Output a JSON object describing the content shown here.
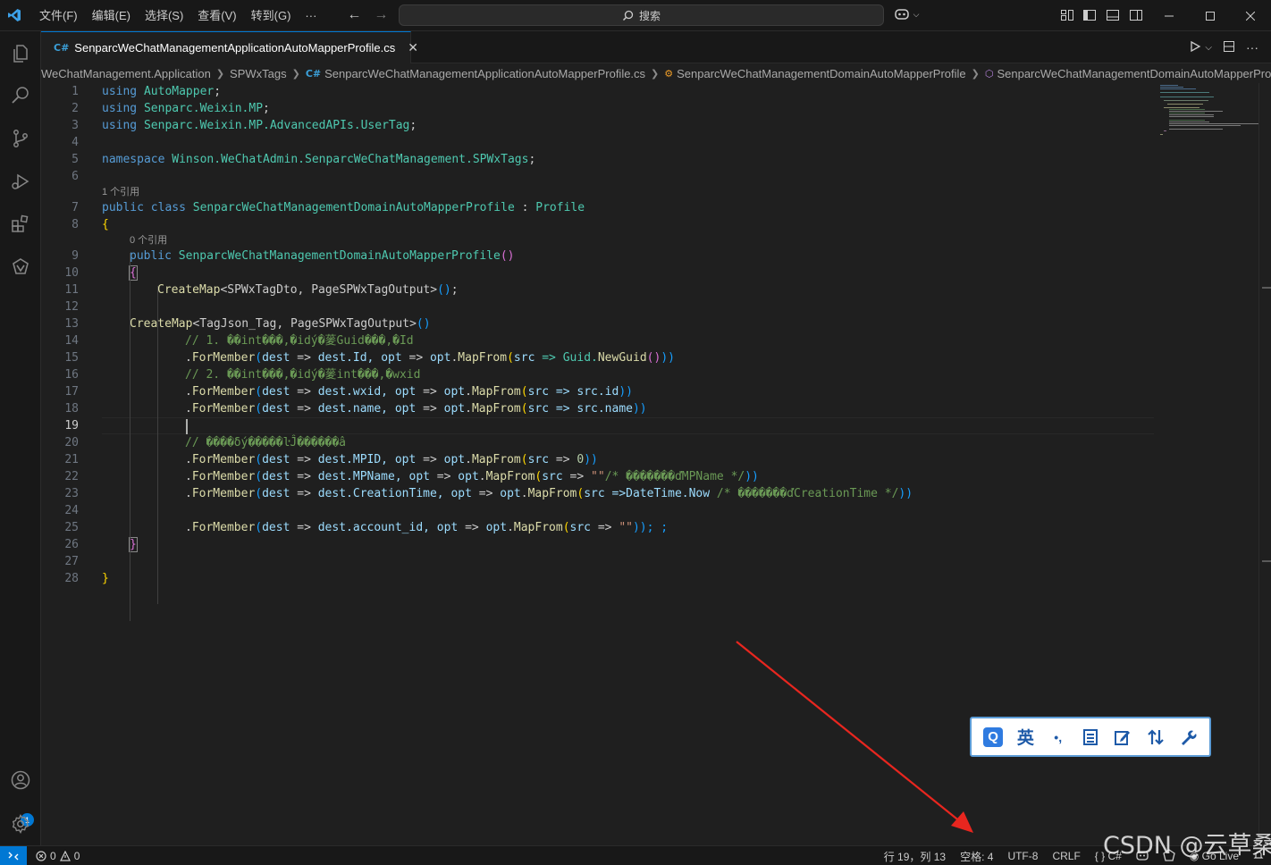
{
  "menu": [
    "文件(F)",
    "编辑(E)",
    "选择(S)",
    "查看(V)",
    "转到(G)",
    "···"
  ],
  "search": {
    "placeholder": "搜索"
  },
  "tab": {
    "label": "SenparcWeChatManagementApplicationAutoMapperProfile.cs",
    "close": "✕"
  },
  "breadcrumb": [
    "WeChatManagement.Application",
    "SPWxTags",
    "SenparcWeChatManagementApplicationAutoMapperProfile.cs",
    "SenparcWeChatManagementDomainAutoMapperProfile",
    "SenparcWeChatManagementDomainAutoMapperProfile"
  ],
  "codelens": {
    "class_refs": "1 个引用",
    "ctor_refs": "0 个引用"
  },
  "code": {
    "line_numbers": [
      "1",
      "2",
      "3",
      "4",
      "5",
      "6",
      "7",
      "8",
      "9",
      "10",
      "11",
      "12",
      "13",
      "14",
      "15",
      "16",
      "17",
      "18",
      "19",
      "20",
      "21",
      "22",
      "23",
      "24",
      "25",
      "26",
      "27",
      "28"
    ],
    "current_line": "19",
    "l1": {
      "a": "using",
      "b": "AutoMapper",
      "c": ";"
    },
    "l2": {
      "a": "using",
      "b": "Senparc.Weixin.MP",
      "c": ";"
    },
    "l3": {
      "a": "using",
      "b": "Senparc.Weixin.MP.AdvancedAPIs.UserTag",
      "c": ";"
    },
    "l5": {
      "a": "namespace",
      "b": "Winson.WeChatAdmin.SenparcWeChatManagement.SPWxTags",
      "c": ";"
    },
    "l7": {
      "a": "public class",
      "b": "SenparcWeChatManagementDomainAutoMapperProfile",
      "c": " : ",
      "d": "Profile"
    },
    "l8": "{",
    "l9": {
      "a": "public",
      "b": "SenparcWeChatManagementDomainAutoMapperProfile",
      "c": "()"
    },
    "l10": "{",
    "l11": {
      "a": "CreateMap",
      "b": "<SPWxTagDto, PageSPWxTagOutput>",
      "c": "()",
      "d": ";"
    },
    "l13": {
      "a": "CreateMap",
      "b": "<TagJson_Tag, PageSPWxTagOutput>",
      "c": "()"
    },
    "l14": "// 1. ��int���,�idý�蓌Guid���,�Id",
    "l15": {
      "a": ".",
      "b": "ForMember",
      "c": "(",
      "d": "dest",
      "e": " => ",
      "f": "dest",
      "g": ".Id, ",
      "h": "opt",
      "i": " => ",
      "j": "opt",
      "k": ".",
      "l": "MapFrom",
      "m": "(",
      "n": "src",
      "o": " => Guid.",
      "p": "NewGuid",
      "q": "()",
      "r": "))"
    },
    "l16": "// 2. ��int���,�idý�蓌int���,�wxid",
    "l17": {
      "a": ".",
      "b": "ForMember",
      "c": "(",
      "d": "dest",
      "e": " => ",
      "f": "dest",
      "g": ".wxid, ",
      "h": "opt",
      "i": " => ",
      "j": "opt",
      "k": ".",
      "l": "MapFrom",
      "m": "(",
      "n": "src",
      "o": " => src.id",
      "r": "))"
    },
    "l18": {
      "a": ".",
      "b": "ForMember",
      "c": "(",
      "d": "dest",
      "e": " => ",
      "f": "dest",
      "g": ".name, ",
      "h": "opt",
      "i": " => ",
      "j": "opt",
      "k": ".",
      "l": "MapFrom",
      "m": "(",
      "n": "src",
      "o": " => src.name",
      "r": "))"
    },
    "l20": "// ����δý�����ŀĴ������â",
    "l21": {
      "a": ".",
      "b": "ForMember",
      "c": "(",
      "d": "dest",
      "e": " => ",
      "f": "dest",
      "g": ".MPID, ",
      "h": "opt",
      "i": " => ",
      "j": "opt",
      "k": ".",
      "l": "MapFrom",
      "m": "(",
      "n": "src",
      "o": " => ",
      "num": "0",
      "r": "))"
    },
    "l22": {
      "a": ".",
      "b": "ForMember",
      "c": "(",
      "d": "dest",
      "e": " => ",
      "f": "dest",
      "g": ".MPName, ",
      "h": "opt",
      "i": " => ",
      "j": "opt",
      "k": ".",
      "l": "MapFrom",
      "m": "(",
      "n": "src",
      "o": " => ",
      "s": "\"\"",
      "cm": "/* �������ďMPName */",
      "r": "))"
    },
    "l23": {
      "a": ".",
      "b": "ForMember",
      "c": "(",
      "d": "dest",
      "e": " => ",
      "f": "dest",
      "g": ".CreationTime, ",
      "h": "opt",
      "i": " => ",
      "j": "opt",
      "k": ".",
      "l": "MapFrom",
      "m": "(",
      "n": "src",
      "o": " =>DateTime.Now ",
      "cm": "/* �������ďCreationTime */",
      "r": "))"
    },
    "l25": {
      "a": ".",
      "b": "ForMember",
      "c": "(",
      "d": "dest",
      "e": " => ",
      "f": "dest",
      "g": ".account_id, ",
      "h": "opt",
      "i": " => ",
      "j": "opt",
      "k": ".",
      "l": "MapFrom",
      "m": "(",
      "n": "src",
      "o": " => ",
      "s": "\"\"",
      "r": ")); ;"
    },
    "l26": "}",
    "l28": "}"
  },
  "ime": {
    "items": [
      "Q",
      "英",
      "•,",
      "☰",
      "✎",
      "⇅",
      "🔧"
    ]
  },
  "status": {
    "errors": "0",
    "warnings": "0",
    "position": "行 19，列 13",
    "spaces": "空格: 4",
    "encoding": "UTF-8",
    "eol": "CRLF",
    "language": "{ }  C#",
    "golive": "Go Live"
  },
  "account_badge": "1",
  "watermark": "CSDN @云草桑",
  "colors": {
    "accent": "#0078d4",
    "arrow": "#e8261f"
  }
}
